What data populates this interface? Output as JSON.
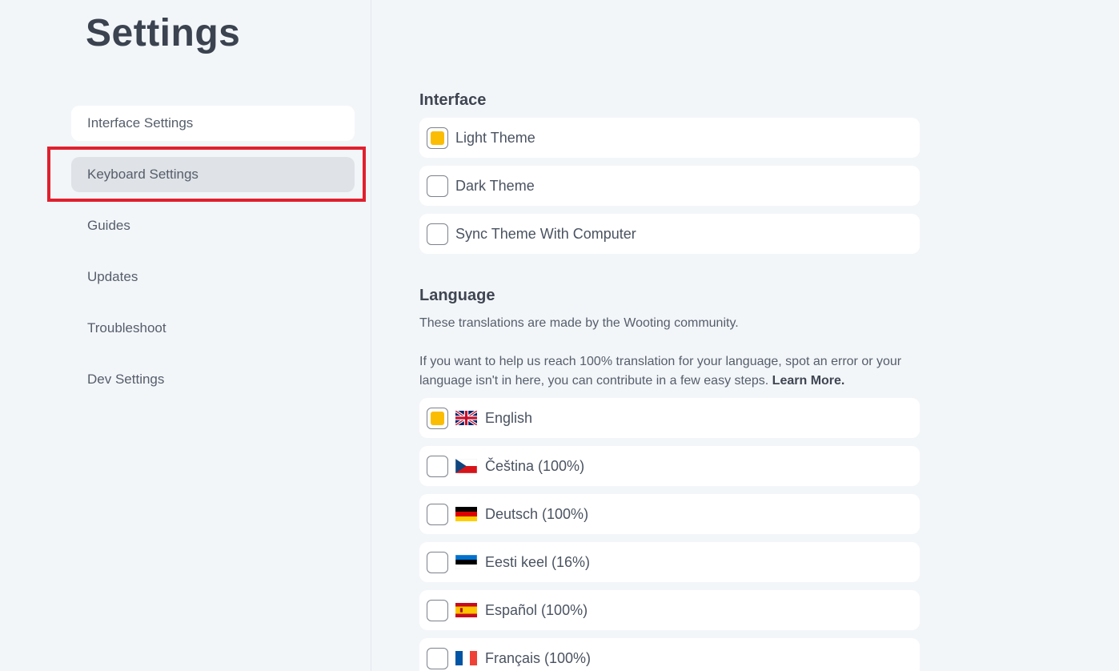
{
  "page": {
    "title": "Settings"
  },
  "sidebar": {
    "items": [
      {
        "label": "Interface Settings",
        "state": "current"
      },
      {
        "label": "Keyboard Settings",
        "state": "hover"
      },
      {
        "label": "Guides",
        "state": "default"
      },
      {
        "label": "Updates",
        "state": "default"
      },
      {
        "label": "Troubleshoot",
        "state": "default"
      },
      {
        "label": "Dev Settings",
        "state": "default"
      }
    ]
  },
  "interface": {
    "title": "Interface",
    "options": [
      {
        "label": "Light Theme",
        "checked": true
      },
      {
        "label": "Dark Theme",
        "checked": false
      },
      {
        "label": "Sync Theme With Computer",
        "checked": false
      }
    ]
  },
  "language": {
    "title": "Language",
    "description": "These translations are made by the Wooting community.",
    "contribute_text": "If you want to help us reach 100% translation for your language, spot an error or your language isn't in here, you can contribute in a few easy steps.",
    "learn_more": "Learn More.",
    "options": [
      {
        "label": "English",
        "flag": "uk-flag-icon",
        "checked": true
      },
      {
        "label": "Čeština (100%)",
        "flag": "czech-flag-icon",
        "checked": false
      },
      {
        "label": "Deutsch (100%)",
        "flag": "german-flag-icon",
        "checked": false
      },
      {
        "label": "Eesti keel (16%)",
        "flag": "estonian-flag-icon",
        "checked": false
      },
      {
        "label": "Español (100%)",
        "flag": "spanish-flag-icon",
        "checked": false
      },
      {
        "label": "Français (100%)",
        "flag": "french-flag-icon",
        "checked": false
      }
    ]
  },
  "colors": {
    "accent": "#fbbd04",
    "highlight": "#e0202e",
    "background": "#f3f6f9",
    "card": "#ffffff"
  }
}
